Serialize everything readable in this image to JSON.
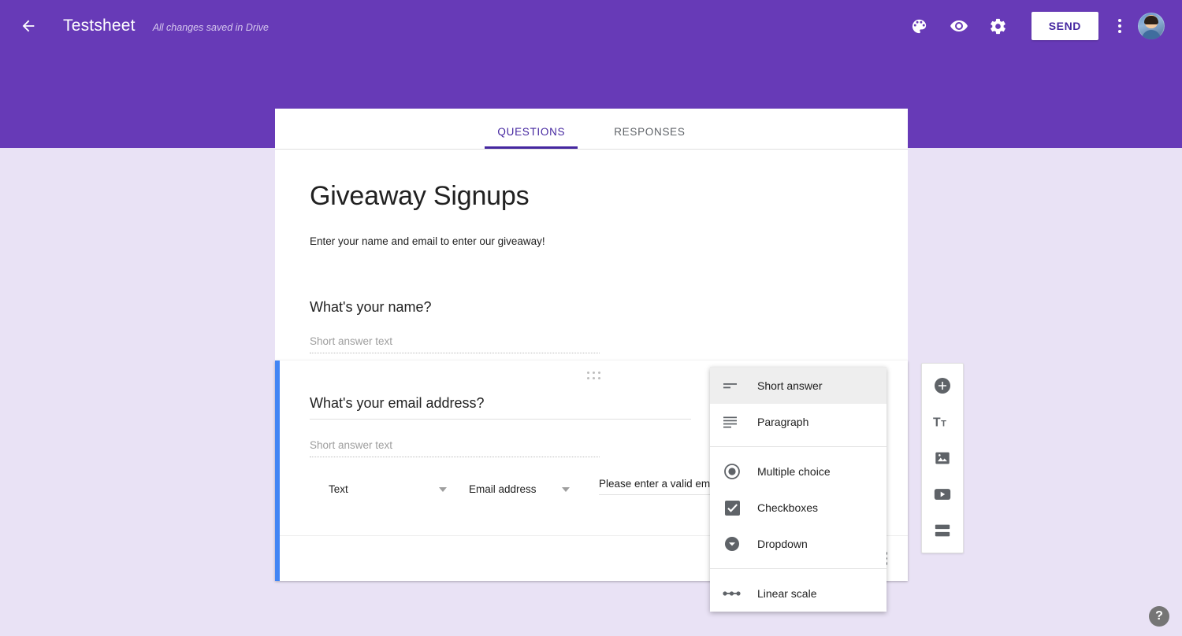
{
  "header": {
    "back_icon": "arrow-back-icon",
    "doc_title": "Testsheet",
    "save_status": "All changes saved in Drive",
    "palette_icon": "palette-icon",
    "preview_icon": "eye-preview-icon",
    "settings_icon": "gear-icon",
    "send_label": "SEND",
    "more_icon": "kebab-menu-icon",
    "avatar_icon": "user-avatar",
    "brand_color": "#673ab7",
    "accent_color": "#4527a0"
  },
  "tabs": [
    {
      "label": "QUESTIONS",
      "active": true
    },
    {
      "label": "RESPONSES",
      "active": false
    }
  ],
  "form": {
    "title": "Giveaway Signups",
    "description": "Enter your name and email to enter our giveaway!"
  },
  "questions": [
    {
      "title": "What's your name?",
      "answer_placeholder": "Short answer text"
    },
    {
      "title": "What's your email address?",
      "answer_placeholder": "Short answer text",
      "selected": true,
      "accent_color": "#4285f4",
      "validation": {
        "type_value": "Text",
        "rule_value": "Email address",
        "error_text": "Please enter a valid email"
      },
      "footer": {
        "duplicate_icon": "duplicate-icon",
        "more_icon": "more-vertical-icon"
      }
    }
  ],
  "side_tools": [
    {
      "icon": "add-question-icon",
      "name": "add-question"
    },
    {
      "icon": "title-text-icon",
      "name": "add-title-description"
    },
    {
      "icon": "image-icon",
      "name": "add-image"
    },
    {
      "icon": "video-icon",
      "name": "add-video"
    },
    {
      "icon": "section-icon",
      "name": "add-section"
    }
  ],
  "type_menu": {
    "groups": [
      [
        {
          "label": "Short answer",
          "icon": "short-answer-icon",
          "selected": true
        },
        {
          "label": "Paragraph",
          "icon": "paragraph-icon",
          "selected": false
        }
      ],
      [
        {
          "label": "Multiple choice",
          "icon": "radio-icon",
          "selected": false
        },
        {
          "label": "Checkboxes",
          "icon": "checkbox-icon",
          "selected": false
        },
        {
          "label": "Dropdown",
          "icon": "dropdown-icon",
          "selected": false
        }
      ],
      [
        {
          "label": "Linear scale",
          "icon": "linear-scale-icon",
          "selected": false
        }
      ]
    ]
  },
  "help": {
    "label": "?"
  },
  "page": {
    "background": "#e9e2f5"
  }
}
